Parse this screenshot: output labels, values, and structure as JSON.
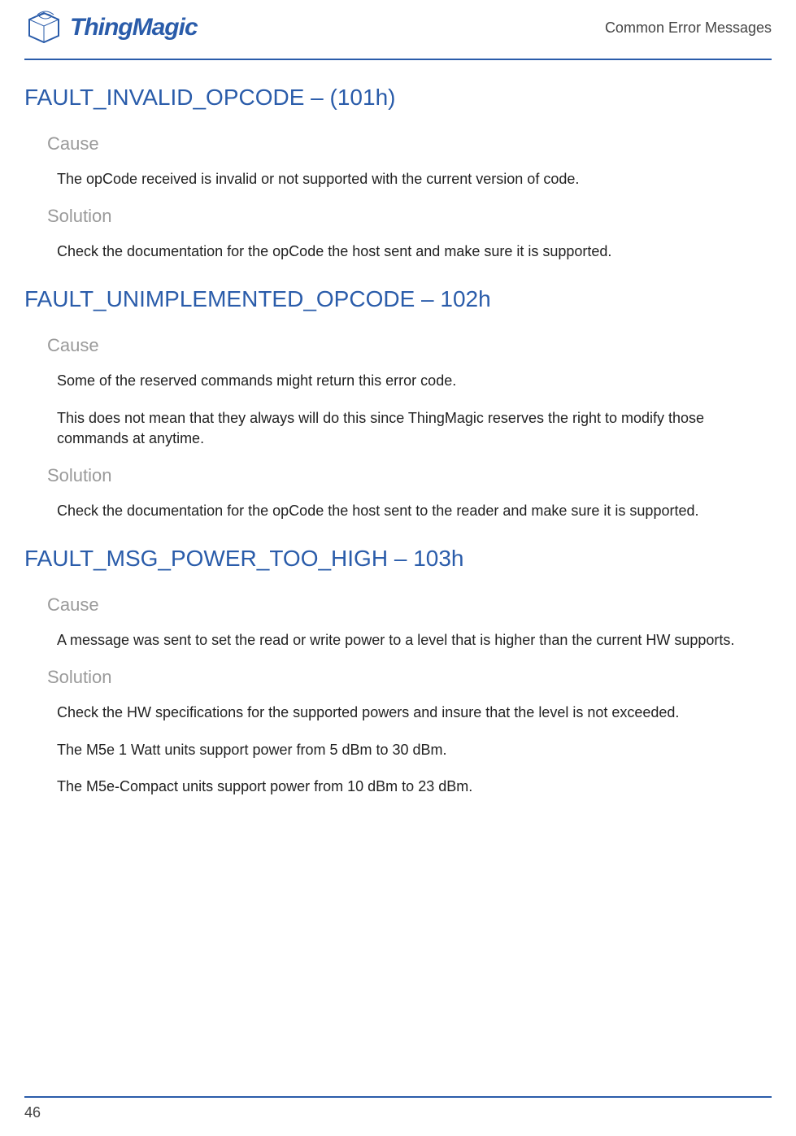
{
  "header": {
    "logo_text": "ThingMagic",
    "right_text": "Common Error Messages"
  },
  "sections": [
    {
      "title": "FAULT_INVALID_OPCODE – (101h)",
      "blocks": [
        {
          "heading": "Cause",
          "paras": [
            "The opCode received is invalid or not supported with the current version of code."
          ]
        },
        {
          "heading": "Solution",
          "paras": [
            "Check the documentation for the opCode the host sent and make sure it is supported."
          ]
        }
      ]
    },
    {
      "title": "FAULT_UNIMPLEMENTED_OPCODE – 102h",
      "blocks": [
        {
          "heading": "Cause",
          "paras": [
            "Some of the reserved commands might return this error code.",
            "This does not mean that they always will do this since ThingMagic reserves the right to modify those commands at anytime."
          ]
        },
        {
          "heading": "Solution",
          "paras": [
            "Check the documentation for the opCode the host sent to the reader and make sure it is supported."
          ]
        }
      ]
    },
    {
      "title": "FAULT_MSG_POWER_TOO_HIGH – 103h",
      "blocks": [
        {
          "heading": "Cause",
          "paras": [
            "A message was sent to set the read or write power to a level that is higher than the current HW supports."
          ]
        },
        {
          "heading": "Solution",
          "paras": [
            "Check the HW specifications for the supported powers and insure that the level is not exceeded.",
            "The M5e 1 Watt units support power from 5 dBm to 30 dBm.",
            "The M5e-Compact units support power from 10 dBm to 23 dBm."
          ]
        }
      ]
    }
  ],
  "footer": {
    "page_number": "46"
  }
}
